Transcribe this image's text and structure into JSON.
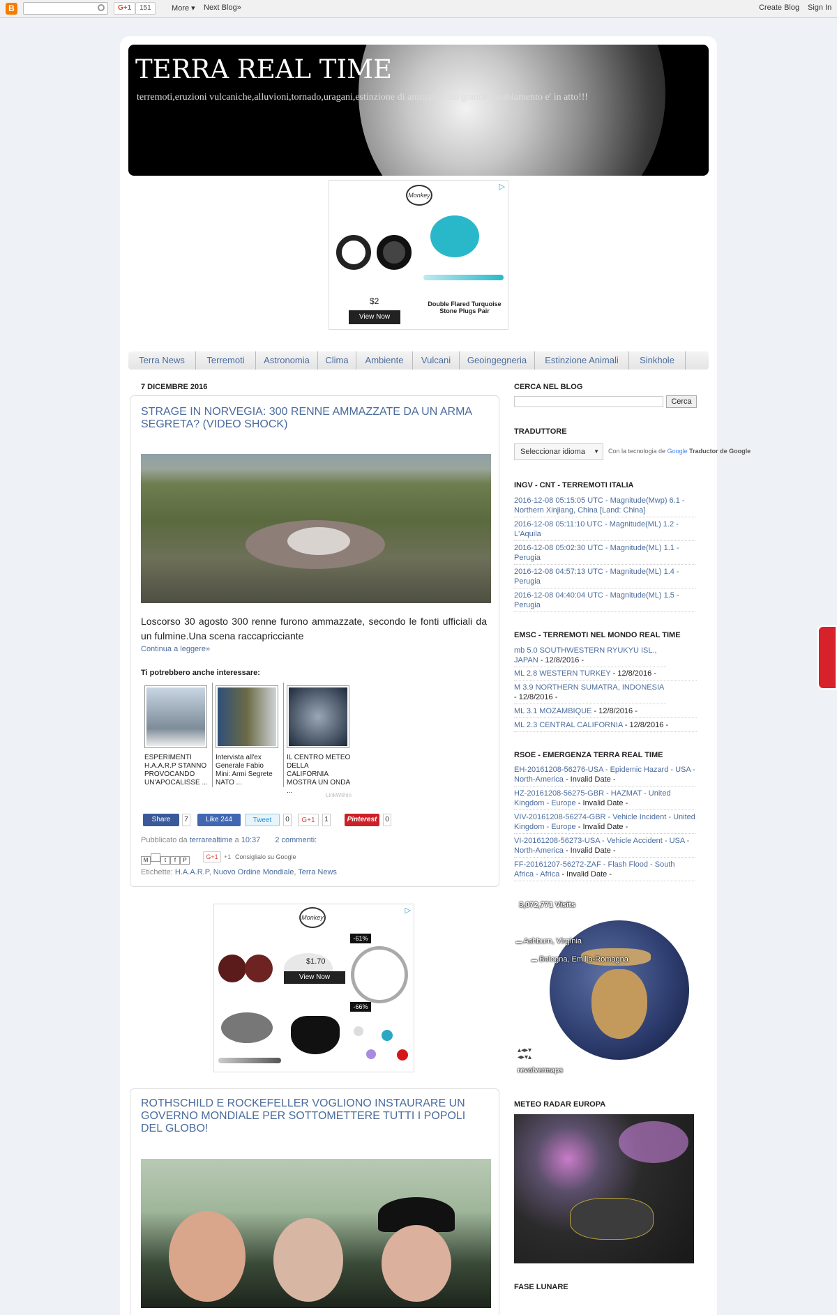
{
  "navbar": {
    "logo": "B",
    "gplus": "G+1",
    "count": "151",
    "more": "More ▾",
    "next": "Next Blog»",
    "create": "Create Blog",
    "signin": "Sign In"
  },
  "header": {
    "title": "TERRA REAL TIME",
    "description": "terremoti,eruzioni vulcaniche,alluvioni,tornado,uragani,estinzione di animali.....un grande cambiamento e' in atto!!!"
  },
  "ad1": {
    "price": "$2",
    "view": "View Now",
    "caption": "Double Flared Turquoise Stone Plugs Pair",
    "logo": "Monkey"
  },
  "tabs": [
    "Terra News",
    "Terremoti",
    "Astronomia",
    "Clima",
    "Ambiente",
    "Vulcani",
    "Geoingegneria",
    "Estinzione Animali",
    "Sinkhole"
  ],
  "date": "7 DICEMBRE 2016",
  "post1": {
    "title": "STRAGE IN NORVEGIA: 300 RENNE AMMAZZATE DA UN ARMA SEGRETA? (VIDEO SHOCK)",
    "text": "Loscorso 30 agosto 300 renne furono ammazzate, secondo le fonti ufficiali da un fulmine.Una scena raccapricciante",
    "more": "Continua a leggere»",
    "related_title": "Ti potrebbero anche interessare:",
    "related": [
      "ESPERIMENTI H.A.A.R.P STANNO PROVOCANDO UN'APOCALISSE ...",
      "Intervista all'ex Generale Fabio Mini: Armi Segrete NATO ...",
      "IL CENTRO METEO DELLA CALIFORNIA MOSTRA UN ONDA ..."
    ],
    "linkwithin": "LinkWithin",
    "share": "Share",
    "share_count": "7",
    "like": "Like 244",
    "tweet": "Tweet",
    "tweet_count": "0",
    "gplus": "G+1",
    "gplus_count": "1",
    "pinterest": "Pinterest",
    "pin_count": "0",
    "posted": "Pubblicato da",
    "author": "terrarealtime",
    "at": "a",
    "time": "10:37",
    "comments": "2 commenti:",
    "plus1": "+1",
    "consigliato": "Consiglialo su Google",
    "labels_prefix": "Etichette:",
    "labels": [
      "H.A.A.R.P",
      "Nuovo Ordine Mondiale",
      "Terra News"
    ]
  },
  "ad2": {
    "price": "$1.70",
    "view": "View Now",
    "badge1": "-61%",
    "badge2": "-66%"
  },
  "post2": {
    "title": "ROTHSCHILD E ROCKEFELLER VOGLIONO INSTAURARE UN GOVERNO MONDIALE PER SOTTOMETTERE TUTTI I POPOLI DEL GLOBO!"
  },
  "sidebar": {
    "search_title": "CERCA NEL BLOG",
    "search_button": "Cerca",
    "translator_title": "TRADUTTORE",
    "translator_select": "Seleccionar idioma",
    "translator_note": "Con la tecnologia de",
    "translator_google": "Google",
    "translator_brand": "Traductor de Google",
    "ingv_title": "INGV - CNT - TERREMOTI ITALIA",
    "ingv": [
      "2016-12-08 05:15:05 UTC - Magnitude(Mwp) 6.1 - Northern Xinjiang, China [Land: China]",
      "2016-12-08 05:11:10 UTC - Magnitude(ML) 1.2 - L'Aquila",
      "2016-12-08 05:02:30 UTC - Magnitude(ML) 1.1 - Perugia",
      "2016-12-08 04:57:13 UTC - Magnitude(ML) 1.4 - Perugia",
      "2016-12-08 04:40:04 UTC - Magnitude(ML) 1.5 - Perugia"
    ],
    "emsc_title": "EMSC - TERREMOTI NEL MONDO REAL TIME",
    "emsc": [
      {
        "link": "mb 5.0 SOUTHWESTERN RYUKYU ISL., JAPAN",
        "date": " - 12/8/2016 -"
      },
      {
        "link": "ML 2.8 WESTERN TURKEY",
        "date": " - 12/8/2016 -"
      },
      {
        "link": "M 3.9 NORTHERN SUMATRA, INDONESIA",
        "date": " - 12/8/2016 -"
      },
      {
        "link": "ML 3.1 MOZAMBIQUE",
        "date": " - 12/8/2016 -"
      },
      {
        "link": "ML 2.3 CENTRAL CALIFORNIA",
        "date": " - 12/8/2016 -"
      }
    ],
    "rsoe_title": "RSOE - EMERGENZA TERRA REAL TIME",
    "rsoe": [
      {
        "link": "EH-20161208-56276-USA - Epidemic Hazard - USA - North-America",
        "date": " - Invalid Date -"
      },
      {
        "link": "HZ-20161208-56275-GBR - HAZMAT - United Kingdom - Europe",
        "date": " - Invalid Date -"
      },
      {
        "link": "VIV-20161208-56274-GBR - Vehicle Incident - United Kingdom - Europe",
        "date": " - Invalid Date -"
      },
      {
        "link": "VI-20161208-56273-USA - Vehicle Accident - USA - North-America",
        "date": " - Invalid Date -"
      },
      {
        "link": "FF-20161207-56272-ZAF - Flash Flood - South Africa - Africa",
        "date": " - Invalid Date -"
      }
    ],
    "visits": "3,072,771 Visits",
    "ashburn": "Ashburn, Virginia",
    "bologna": "Bologna, Emilia-Romagna",
    "revolver": "revolvermaps",
    "radar_title": "METEO RADAR EUROPA",
    "fase_title": "FASE LUNARE"
  },
  "colors": {
    "link": "#4b6c9e",
    "navbar": "#f1f1f1",
    "background": "#eef1f5",
    "ad_turquoise": "#29b8c9"
  }
}
